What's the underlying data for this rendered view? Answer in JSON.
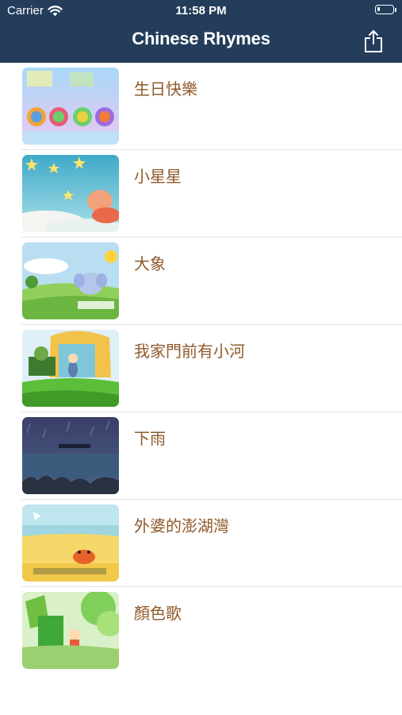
{
  "status_bar": {
    "carrier": "Carrier",
    "time": "11:58 PM",
    "battery_level": 0.2
  },
  "nav": {
    "title": "Chinese Rhymes",
    "share_icon": "share-icon"
  },
  "colors": {
    "nav_background": "#233d5b",
    "row_label": "#8f5a2a",
    "separator": "#e3e3e6"
  },
  "rhymes": [
    {
      "label": "生日快樂"
    },
    {
      "label": "小星星"
    },
    {
      "label": "大象"
    },
    {
      "label": "我家門前有小河"
    },
    {
      "label": "下雨"
    },
    {
      "label": "外婆的澎湖灣"
    },
    {
      "label": "顏色歌"
    }
  ]
}
